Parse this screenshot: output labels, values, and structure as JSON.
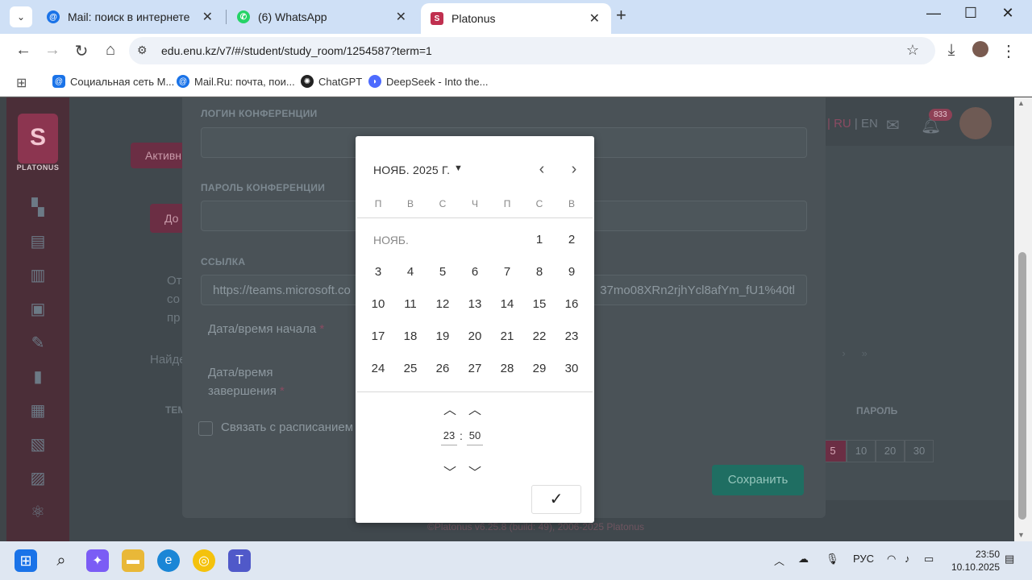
{
  "browser": {
    "tabs": [
      {
        "label": "Mail: поиск в интернете",
        "icon": "mail-icon"
      },
      {
        "label": "(6) WhatsApp",
        "icon": "whatsapp-icon"
      },
      {
        "label": "Platonus",
        "icon": "platonus-icon"
      }
    ],
    "url": "edu.enu.kz/v7/#/student/study_room/1254587?term=1",
    "bookmarks": [
      {
        "label": "Социальная сеть М...",
        "icon": "mailru-icon"
      },
      {
        "label": "Mail.Ru: почта, пои...",
        "icon": "mail-icon"
      },
      {
        "label": "ChatGPT",
        "icon": "chatgpt-icon"
      },
      {
        "label": "DeepSeek - Into the...",
        "icon": "deepseek-icon"
      }
    ]
  },
  "app": {
    "logo_text": "PLATONUS",
    "lang": {
      "ru": "RU",
      "sep": "|",
      "en": "EN",
      "prefix": "|"
    },
    "notifications_count": "833",
    "bg_button_active": "Активн",
    "bg_button_add": "До",
    "bg_text": [
      "От",
      "со",
      "пр"
    ],
    "bg_search_label": "Найде",
    "bg_col_left": "ТЕМ",
    "bg_col_password": "ПАРОЛЬ",
    "page_sizes": [
      "5",
      "10",
      "20",
      "30"
    ],
    "footer": "©Platonus v6.25.8 (build: 49), 2006-2025 Platonus"
  },
  "modal": {
    "login_label": "ЛОГИН КОНФЕРЕНЦИИ",
    "login_value": "",
    "password_label": "ПАРОЛЬ КОНФЕРЕНЦИИ",
    "password_value": "",
    "link_label": "ССЫЛКА",
    "link_value_start": "https://teams.microsoft.co",
    "link_value_end": "37mo08XRn2rjhYcl8afYm_fU1%40tl",
    "start_label": "Дата/время начала",
    "end_label_line1": "Дата/время",
    "end_label_line2": "завершения",
    "required_mark": "*",
    "schedule_checkbox_label": "Связать с расписанием з",
    "save_label": "Сохранить"
  },
  "datepicker": {
    "month_label": "НОЯБ. 2025 Г.",
    "month_short": "НОЯБ.",
    "weekdays": [
      "П",
      "В",
      "С",
      "Ч",
      "П",
      "С",
      "В"
    ],
    "weeks": [
      [
        "",
        "",
        "",
        "",
        "",
        "1",
        "2"
      ],
      [
        "3",
        "4",
        "5",
        "6",
        "7",
        "8",
        "9"
      ],
      [
        "10",
        "11",
        "12",
        "13",
        "14",
        "15",
        "16"
      ],
      [
        "17",
        "18",
        "19",
        "20",
        "21",
        "22",
        "23"
      ],
      [
        "24",
        "25",
        "26",
        "27",
        "28",
        "29",
        "30"
      ]
    ],
    "hours": "23",
    "minutes": "50",
    "time_separator": ":"
  },
  "taskbar": {
    "lang": "РУС",
    "time": "23:50",
    "date": "10.10.2025"
  }
}
